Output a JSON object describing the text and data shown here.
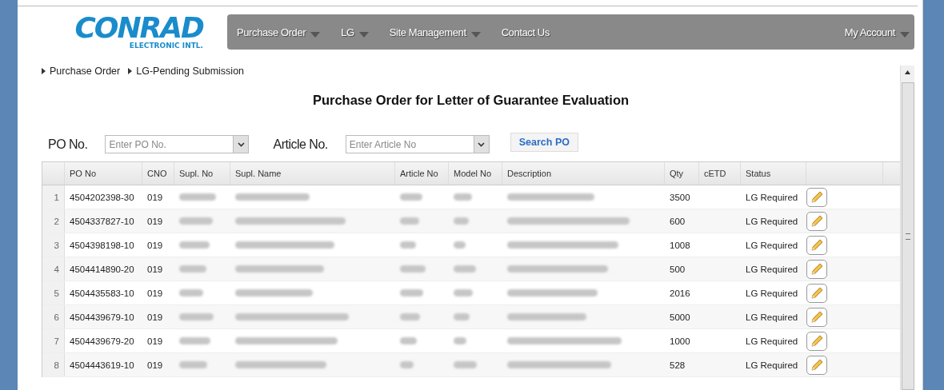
{
  "logo": {
    "name": "CONRAD",
    "tagline": "ELECTRONIC INTL."
  },
  "nav": [
    {
      "label": "Purchase Order",
      "dropdown": true
    },
    {
      "label": "LG",
      "dropdown": true
    },
    {
      "label": "Site Management",
      "dropdown": true
    },
    {
      "label": "Contact Us",
      "dropdown": false
    }
  ],
  "account": {
    "label": "My Account",
    "dropdown": true
  },
  "breadcrumb": [
    "Purchase Order",
    "LG-Pending Submission"
  ],
  "title": "Purchase Order for Letter of Guarantee Evaluation",
  "search": {
    "po_label": "PO No.",
    "po_placeholder": "Enter PO No.",
    "article_label": "Article No.",
    "article_placeholder": "Enter Article No",
    "button": "Search PO"
  },
  "table": {
    "columns": [
      {
        "label": "PO No",
        "redacted": false
      },
      {
        "label": "CNO",
        "redacted": false
      },
      {
        "label": "Supl. No",
        "redacted": true
      },
      {
        "label": "Supl. Name",
        "redacted": true
      },
      {
        "label": "Article No",
        "redacted": true
      },
      {
        "label": "Model No",
        "redacted": true
      },
      {
        "label": "Description",
        "redacted": true
      },
      {
        "label": "Qty",
        "redacted": false
      },
      {
        "label": "cETD",
        "redacted": false
      },
      {
        "label": "Status",
        "redacted": false
      }
    ],
    "rows": [
      {
        "index": "1",
        "po_no": "4504202398-30",
        "cno": "019",
        "qty": "3500",
        "status": "LG Required",
        "editable": true
      },
      {
        "index": "2",
        "po_no": "4504337827-10",
        "cno": "019",
        "qty": "600",
        "status": "LG Required",
        "editable": true
      },
      {
        "index": "3",
        "po_no": "4504398198-10",
        "cno": "019",
        "qty": "1008",
        "status": "LG Required",
        "editable": true
      },
      {
        "index": "4",
        "po_no": "4504414890-20",
        "cno": "019",
        "qty": "500",
        "status": "LG Required",
        "editable": true
      },
      {
        "index": "5",
        "po_no": "4504435583-10",
        "cno": "019",
        "qty": "2016",
        "status": "LG Required",
        "editable": true
      },
      {
        "index": "6",
        "po_no": "4504439679-10",
        "cno": "019",
        "qty": "5000",
        "status": "LG Required",
        "editable": true
      },
      {
        "index": "7",
        "po_no": "4504439679-20",
        "cno": "019",
        "qty": "1000",
        "status": "LG Required",
        "editable": true
      },
      {
        "index": "8",
        "po_no": "4504443619-10",
        "cno": "019",
        "qty": "528",
        "status": "LG Required",
        "editable": true
      }
    ]
  }
}
